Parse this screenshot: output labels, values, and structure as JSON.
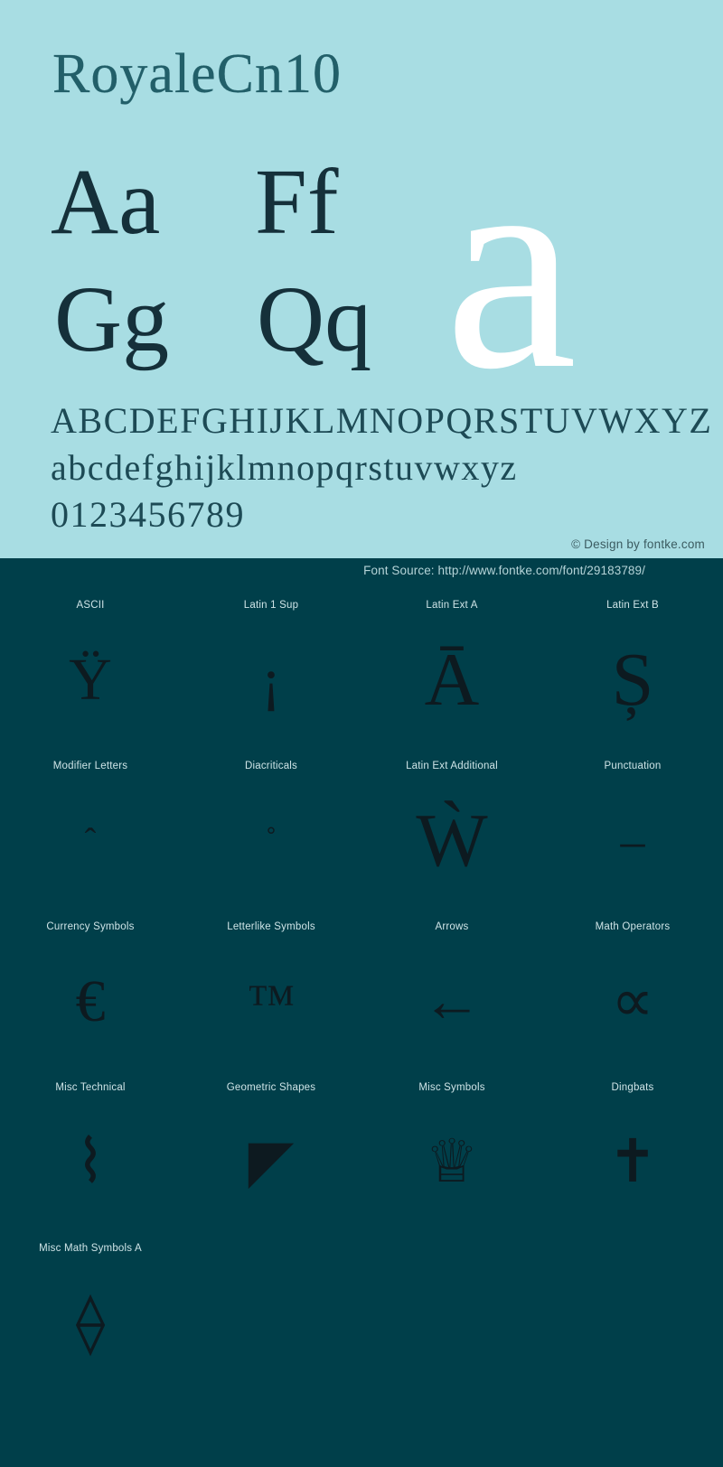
{
  "theme": {
    "light_bg": "#a8dde3",
    "dark_bg": "#003f4a",
    "glyph_dark": "#15303a",
    "glyph_white": "#ffffff",
    "label_color": "#cfe4e7",
    "title_color": "#17555f"
  },
  "header": {
    "font_name": "RoyaleCn10"
  },
  "samples": {
    "pair_1": "Aa",
    "pair_2": "Ff",
    "pair_3": "Gg",
    "pair_4": "Qq",
    "hero_glyph": "a"
  },
  "alphabet": {
    "uppercase": "ABCDEFGHIJKLMNOPQRSTUVWXYZ",
    "lowercase": "abcdefghijklmnopqrstuvwxyz",
    "digits": "0123456789"
  },
  "credit": "© Design by fontke.com",
  "source": "Font Source: http://www.fontke.com/font/29183789/",
  "blocks": [
    {
      "label": "ASCII",
      "glyph": "Ÿ",
      "size": "md"
    },
    {
      "label": "Latin 1 Sup",
      "glyph": "¡",
      "size": "md"
    },
    {
      "label": "Latin Ext A",
      "glyph": "Ā",
      "size": ""
    },
    {
      "label": "Latin Ext B",
      "glyph": "Ș",
      "size": ""
    },
    {
      "label": "Modifier Letters",
      "glyph": "ˆ",
      "size": "xs"
    },
    {
      "label": "Diacriticals",
      "glyph": "̊",
      "size": "xs"
    },
    {
      "label": "Latin Ext Additional",
      "glyph": "Ẁ",
      "size": ""
    },
    {
      "label": "Punctuation",
      "glyph": "–",
      "size": "sm"
    },
    {
      "label": "Currency Symbols",
      "glyph": "€",
      "size": "md"
    },
    {
      "label": "Letterlike Symbols",
      "glyph": "™",
      "size": "sm"
    },
    {
      "label": "Arrows",
      "glyph": "←",
      "size": "md"
    },
    {
      "label": "Math Operators",
      "glyph": "∝",
      "size": "md"
    },
    {
      "label": "Misc Technical",
      "glyph": "⌇",
      "size": "md"
    },
    {
      "label": "Geometric Shapes",
      "glyph": "◤",
      "size": "md"
    },
    {
      "label": "Misc Symbols",
      "glyph": "♕",
      "size": "md"
    },
    {
      "label": "Dingbats",
      "glyph": "✝",
      "size": "md"
    },
    {
      "label": "Misc Math Symbols A",
      "glyph": "⟠",
      "size": "md"
    }
  ]
}
